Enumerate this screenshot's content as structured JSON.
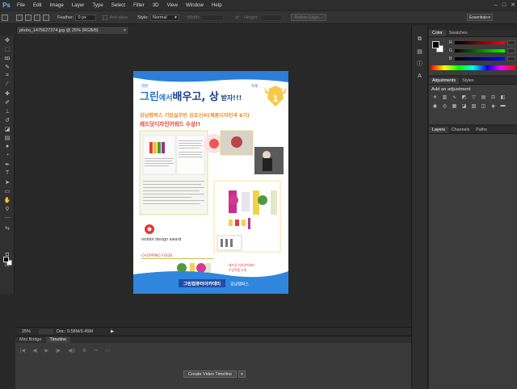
{
  "app": {
    "logo": "Ps"
  },
  "menu": [
    "File",
    "Edit",
    "Image",
    "Layer",
    "Type",
    "Select",
    "Filter",
    "3D",
    "View",
    "Window",
    "Help"
  ],
  "window_controls": [
    "–",
    "□",
    "✕"
  ],
  "options": {
    "feather_label": "Feather:",
    "feather_value": "0 px",
    "antialias_label": "Anti-alias",
    "style_label": "Style:",
    "style_value": "Normal",
    "width_label": "Width:",
    "height_label": "Height:",
    "refine_label": "Refine Edge...",
    "workspace_value": "Essentials"
  },
  "document": {
    "tab_title": "photo_1475627374.jpg @ 25% (RGB/8)",
    "close_glyph": "×",
    "zoom": "25%",
    "doc_info": "Doc: 9.58M/9.45M"
  },
  "poster": {
    "tag_left": "외판",
    "tag_right": "특례",
    "headline_a": "그린",
    "headline_b": "에서",
    "headline_c": "배우고, 상",
    "headline_d": " 받자!!!",
    "line1": "강남캠퍼스 기업실무반 김호신씨(제품디자인과 6기)",
    "line2": "레드닷디자인어워드 수상!!",
    "reddot": "reddot design award",
    "chopping": "CHOPPING FOOD",
    "caption_a": "레드닷 디자인어워드",
    "caption_b": "수상작품 소개",
    "badge_number": "1",
    "footer_school": "그린컴퓨터아카데미",
    "footer_campus": "강남캠퍼스"
  },
  "timeline": {
    "tabs": [
      "Mini Bridge",
      "Timeline"
    ],
    "controls": [
      "|◀",
      "◀|",
      "▶",
      "|▶",
      "◀))",
      "⚙",
      "✂",
      "▭"
    ],
    "create_button": "Create Video Timeline",
    "dropdown_glyph": "▾"
  },
  "panels": {
    "color_tabs": [
      "Color",
      "Swatches"
    ],
    "rgb_labels": [
      "R",
      "G",
      "B"
    ],
    "adjust_tabs": [
      "Adjustments",
      "Styles"
    ],
    "adjust_title": "Add an adjustment",
    "layer_tabs": [
      "Layers",
      "Channels",
      "Paths"
    ]
  },
  "colors": {
    "accent_blue": "#1a6fd1",
    "poster_orange": "#f08b1d",
    "poster_yellow": "#f7d54a",
    "poster_red": "#e43c3c"
  }
}
